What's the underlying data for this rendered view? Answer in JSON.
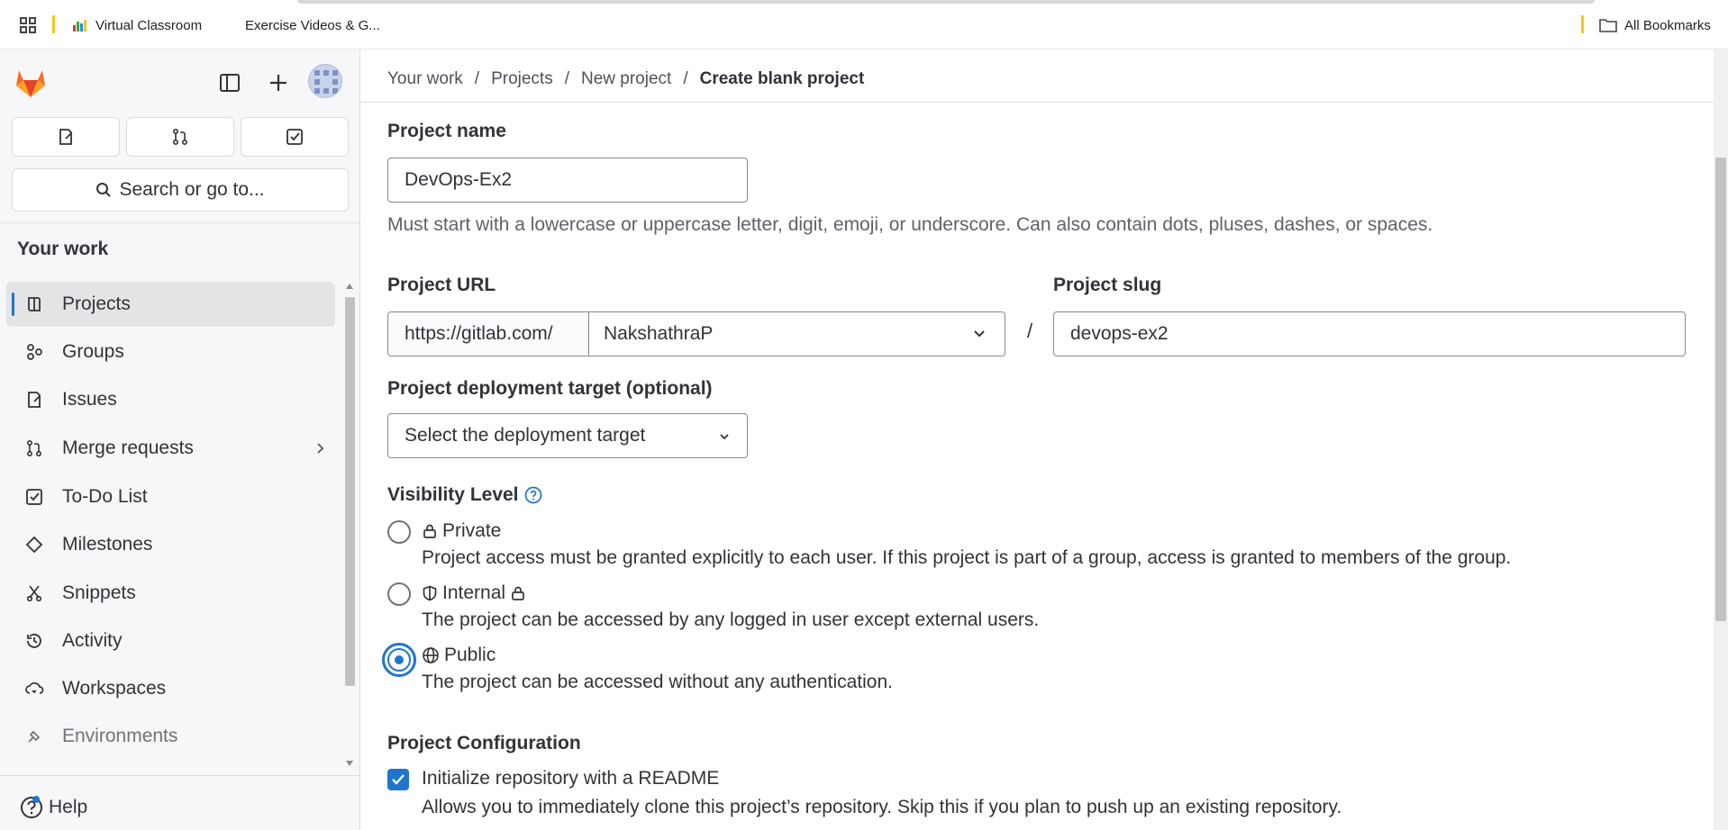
{
  "bookmarks": {
    "items": [
      {
        "label": "Virtual Classroom",
        "icon": "chart-favicon-icon"
      },
      {
        "label": "Exercise Videos & G...",
        "icon": "blank-favicon-icon"
      }
    ],
    "all_bookmarks": "All Bookmarks"
  },
  "sidebar": {
    "search_label": "Search or go to...",
    "section_title": "Your work",
    "items": [
      {
        "label": "Projects",
        "icon": "project-icon",
        "active": true
      },
      {
        "label": "Groups",
        "icon": "group-icon"
      },
      {
        "label": "Issues",
        "icon": "issues-icon"
      },
      {
        "label": "Merge requests",
        "icon": "merge-request-icon"
      },
      {
        "label": "To-Do List",
        "icon": "todo-icon"
      },
      {
        "label": "Milestones",
        "icon": "milestone-icon"
      },
      {
        "label": "Snippets",
        "icon": "snippet-icon"
      },
      {
        "label": "Activity",
        "icon": "history-icon"
      },
      {
        "label": "Workspaces",
        "icon": "workspace-icon"
      },
      {
        "label": "Environments",
        "icon": "environment-icon"
      }
    ],
    "help_label": "Help"
  },
  "breadcrumb": [
    "Your work",
    "Projects",
    "New project",
    "Create blank project"
  ],
  "form": {
    "project_name_label": "Project name",
    "project_name_value": "DevOps-Ex2",
    "project_name_hint": "Must start with a lowercase or uppercase letter, digit, emoji, or underscore. Can also contain dots, pluses, dashes, or spaces.",
    "project_url_label": "Project URL",
    "url_prefix": "https://gitlab.com/",
    "namespace_value": "NakshathraP",
    "slash": "/",
    "project_slug_label": "Project slug",
    "project_slug_value": "devops-ex2",
    "deployment_label": "Project deployment target (optional)",
    "deployment_value": "Select the deployment target",
    "visibility_label": "Visibility Level",
    "visibility_options": [
      {
        "label": "Private",
        "desc": "Project access must be granted explicitly to each user. If this project is part of a group, access is granted to members of the group.",
        "checked": false
      },
      {
        "label": "Internal",
        "desc": "The project can be accessed by any logged in user except external users.",
        "checked": false
      },
      {
        "label": "Public",
        "desc": "The project can be accessed without any authentication.",
        "checked": true
      }
    ],
    "config_label": "Project Configuration",
    "readme_label": "Initialize repository with a README",
    "readme_checked": true,
    "readme_desc": "Allows you to immediately clone this project’s repository. Skip this if you plan to push up an existing repository."
  },
  "colors": {
    "accent": "#1f75cb",
    "gitlab_orange": "#e24329",
    "sidebar_bg": "#f7f7f9"
  }
}
